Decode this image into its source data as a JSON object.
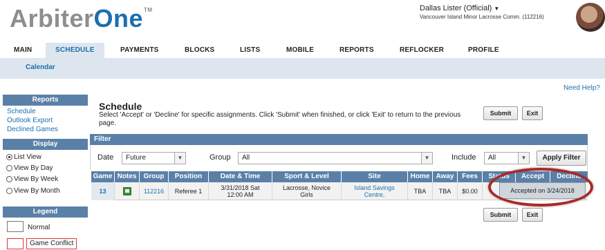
{
  "header": {
    "logo_arbiter": "Arbiter",
    "logo_one": "One",
    "logo_tm": "TM",
    "user_name": "Dallas Lister (Official)",
    "user_org": "Vancouver Island Minor Lacrosse Comm. (112216)"
  },
  "nav": {
    "items": [
      "MAIN",
      "SCHEDULE",
      "PAYMENTS",
      "BLOCKS",
      "LISTS",
      "MOBILE",
      "REPORTS",
      "REFLOCKER",
      "PROFILE"
    ],
    "active": "SCHEDULE",
    "sub_item": "Calendar"
  },
  "sidebar": {
    "reports_title": "Reports",
    "report_links": [
      "Schedule",
      "Outlook Export",
      "Declined Games"
    ],
    "display_title": "Display",
    "display_options": [
      "List View",
      "View By Day",
      "View By Week",
      "View By Month"
    ],
    "display_selected": "List View",
    "legend_title": "Legend",
    "legend_items": [
      "Normal",
      "Game Conflict"
    ]
  },
  "main": {
    "need_help": "Need Help?",
    "title": "Schedule",
    "instructions": "Select 'Accept' or 'Decline' for specific assignments. Click 'Submit' when finished, or click 'Exit' to return to the previous page.",
    "submit_label": "Submit",
    "exit_label": "Exit"
  },
  "filter": {
    "bar_label": "Filter",
    "date_label": "Date",
    "date_value": "Future",
    "group_label": "Group",
    "group_value": "All",
    "include_label": "Include",
    "include_value": "All",
    "apply_label": "Apply Filter"
  },
  "table": {
    "columns": [
      "Game",
      "Notes",
      "Group",
      "Position",
      "Date & Time",
      "Sport & Level",
      "Site",
      "Home",
      "Away",
      "Fees",
      "Status",
      "Accept",
      "Decline"
    ],
    "rows": [
      {
        "game": "13",
        "group": "112216",
        "position": "Referee 1",
        "date_line1": "3/31/2018 Sat",
        "date_line2": "12:00 AM",
        "sport_line1": "Lacrosse, Novice",
        "sport_line2": "Girls",
        "site_line1": "Island Savings",
        "site_line2": "Centre,",
        "home": "TBA",
        "away": "TBA",
        "fees": "$0.00",
        "status": "Accepted on 3/24/2018"
      }
    ]
  },
  "colors": {
    "brand_blue": "#1b6fae",
    "bar_blue": "#5a80a8",
    "highlight_oval": "#a52a2a"
  }
}
